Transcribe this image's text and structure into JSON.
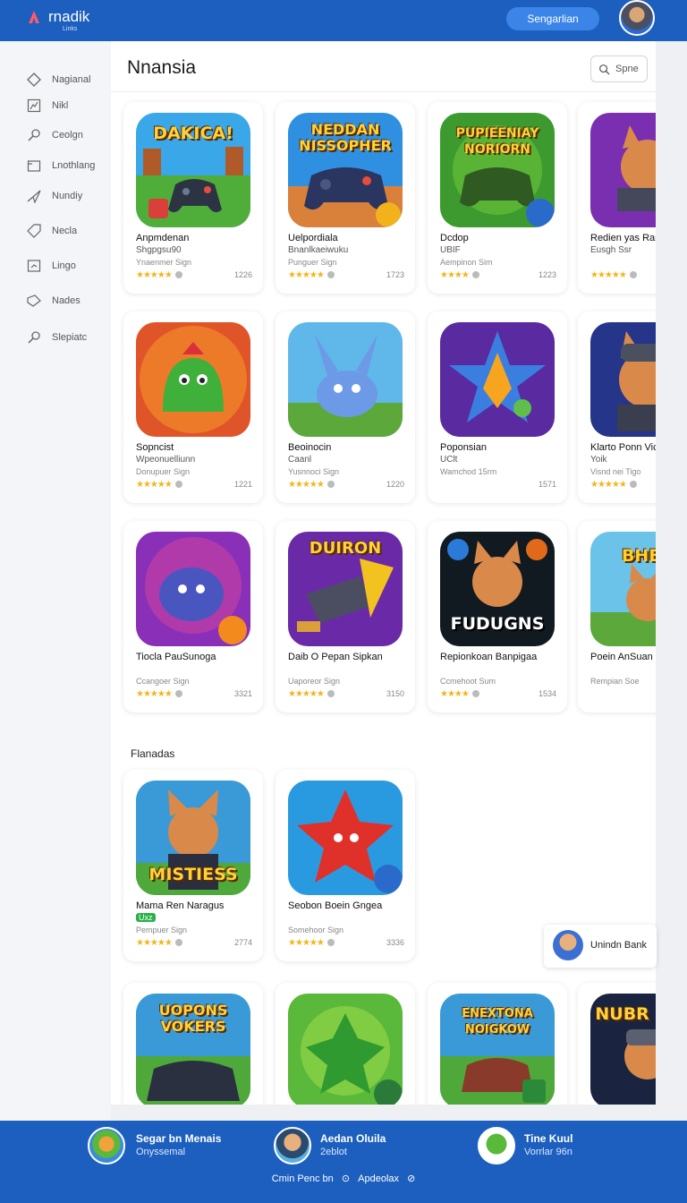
{
  "header": {
    "logo_text": "rnadik",
    "logo_sub": "Links",
    "button_label": "Sengarlian",
    "brand_color": "#1d5fbf"
  },
  "sidebar": {
    "items": [
      {
        "label": "Nagianal",
        "icon": "diamond-icon"
      },
      {
        "label": "Nikl",
        "icon": "chart-icon"
      },
      {
        "label": "Ceolgn",
        "icon": "search-icon"
      },
      {
        "label": "Lnothlang",
        "icon": "folder-icon"
      },
      {
        "label": "Nundiy",
        "icon": "send-icon"
      },
      {
        "label": "Necla",
        "icon": "tag-icon"
      },
      {
        "label": "Lingo",
        "icon": "calendar-icon"
      },
      {
        "label": "Nades",
        "icon": "ticket-icon"
      },
      {
        "label": "Slepiatc",
        "icon": "search-icon"
      }
    ]
  },
  "main": {
    "title": "Nnansia",
    "search_placeholder": "Spne",
    "section_label": "Flanadas",
    "cards": [
      {
        "name": "Anpmdenan",
        "sub": "Shgpgsu90",
        "dev": "Ynaenmer Sign",
        "rating": "★★★★★",
        "count": "1226",
        "tile_text": "DAKICA!",
        "icon": "gamepad-icon"
      },
      {
        "name": "Uelpordiala",
        "sub": "Bnanlkaeiwuku",
        "dev": "Punguer Sign",
        "rating": "★★★★★",
        "count": "1723",
        "tile_text": "NEDDAN NISSOPHER",
        "icon": "gamepad-icon"
      },
      {
        "name": "Dcdop",
        "sub": "UBIF",
        "dev": "Aempinon Sim",
        "rating": "★★★★",
        "count": "1223",
        "tile_text": "PUPIEENIAY NORIORN",
        "icon": "gamepad-icon"
      },
      {
        "name": "Redien yas Ram",
        "sub": "Eusgh Ssr",
        "dev": "",
        "rating": "★★★★★",
        "count": "",
        "tile_text": "",
        "icon": "fox-icon"
      },
      {
        "name": "Sopncist",
        "sub": "Wpeonuelliunn",
        "dev": "Donupuer Sign",
        "rating": "★★★★★",
        "count": "1221",
        "tile_text": "",
        "icon": "creature-icon"
      },
      {
        "name": "Beoinocin",
        "sub": "Caanl",
        "dev": "Yusnnoci Sign",
        "rating": "★★★★★",
        "count": "1220",
        "tile_text": "",
        "icon": "bunny-icon"
      },
      {
        "name": "Poponsian",
        "sub": "UClt",
        "dev": "Wamchod 15rm",
        "rating": "",
        "count": "1571",
        "tile_text": "",
        "icon": "star-icon"
      },
      {
        "name": "Klarto Ponn Vic",
        "sub": "Yoik",
        "dev": "Visnd nei Tigo",
        "rating": "★★★★★",
        "count": "",
        "tile_text": "",
        "icon": "fox-icon"
      },
      {
        "name": "Tiocla PauSunoga",
        "sub": "",
        "dev": "Ccangoer Sign",
        "rating": "★★★★★",
        "count": "3321",
        "tile_text": "",
        "icon": "creature-icon"
      },
      {
        "name": "Daib O Pepan Sipkan",
        "sub": "",
        "dev": "Uaporeor Sign",
        "rating": "★★★★★",
        "count": "3150",
        "tile_text": "DUIRON",
        "icon": "hammer-icon"
      },
      {
        "name": "Repionkoan Banpigaa",
        "sub": "",
        "dev": "Ccmehoot Sum",
        "rating": "★★★★",
        "count": "1534",
        "tile_text": "FUDUGNS",
        "icon": "fox-icon"
      },
      {
        "name": "Poein AnSuan",
        "sub": "",
        "dev": "Rempian Soe",
        "rating": "",
        "count": "",
        "tile_text": "BHEK",
        "icon": "fox-icon"
      },
      {
        "name": "Mama Ren Naragus",
        "sub": "Uxz",
        "dev": "Pempuer Sign",
        "rating": "★★★★★",
        "count": "2774",
        "tile_text": "MISTIESS",
        "icon": "fox-icon"
      },
      {
        "name": "Seobon Boein Gngea",
        "sub": "",
        "dev": "Somehoor Sign",
        "rating": "★★★★★",
        "count": "3336",
        "tile_text": "",
        "icon": "star-icon"
      },
      {
        "name": "",
        "sub": "",
        "dev": "",
        "rating": "",
        "count": "",
        "tile_text": "UOPONS VOKERS",
        "icon": "gamepad-icon"
      },
      {
        "name": "",
        "sub": "",
        "dev": "",
        "rating": "",
        "count": "",
        "tile_text": "",
        "icon": "creature-icon"
      },
      {
        "name": "",
        "sub": "",
        "dev": "",
        "rating": "",
        "count": "",
        "tile_text": "ENEXTONA NOIGKOW",
        "icon": "gamepad-icon"
      },
      {
        "name": "",
        "sub": "",
        "dev": "",
        "rating": "",
        "count": "",
        "tile_text": "NUBR KISA",
        "icon": "fox-icon"
      }
    ],
    "toast_label": "Unindn Bank"
  },
  "footer": {
    "users": [
      {
        "name": "Segar bn Menais",
        "sub": "Onyssemal"
      },
      {
        "name": "Aedan Oluila",
        "sub": "2eblot"
      },
      {
        "name": "Tine Kuul",
        "sub": "Vorrlar 96n"
      }
    ],
    "bottom_left": "Cmin Penc bn",
    "bottom_right": "Apdeolax"
  }
}
